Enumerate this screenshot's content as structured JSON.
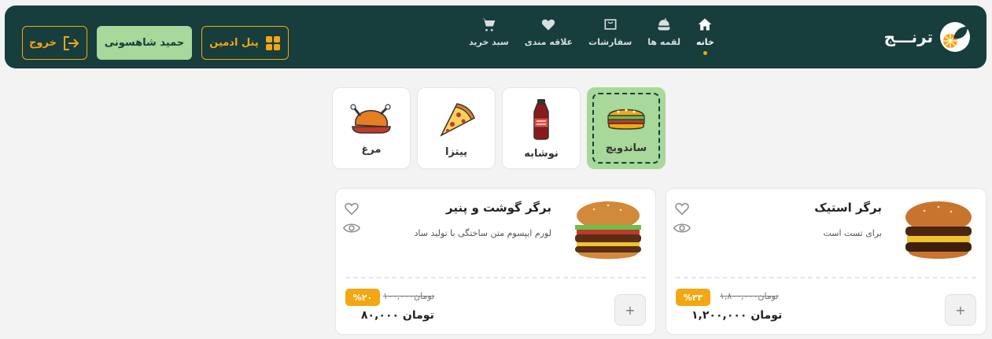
{
  "brand": {
    "name": "ترنـــج"
  },
  "nav": [
    {
      "label": "خانه",
      "icon": "home-icon",
      "active": true
    },
    {
      "label": "لقمه ها",
      "icon": "food-icon"
    },
    {
      "label": "سفارشات",
      "icon": "orders-icon"
    },
    {
      "label": "علاقه مندی",
      "icon": "heart-icon"
    },
    {
      "label": "سبد خرید",
      "icon": "cart-icon"
    }
  ],
  "header": {
    "admin_label": "پنل ادمین",
    "user_label": "حمید شاهسونی",
    "logout_label": "خروج"
  },
  "categories": [
    {
      "label": "ساندویچ",
      "icon": "sandwich-icon",
      "active": true
    },
    {
      "label": "نوشابه",
      "icon": "soda-icon"
    },
    {
      "label": "پیتزا",
      "icon": "pizza-icon"
    },
    {
      "label": "مرغ",
      "icon": "chicken-icon"
    }
  ],
  "products": [
    {
      "title": "برگر استیک",
      "desc": "برای تست است",
      "discount": "%۳۳",
      "old_price": "۱,۸۰۰,۰۰۰تومان",
      "price": "۱,۲۰۰,۰۰۰ تومان"
    },
    {
      "title": "برگر گوشت و پنیر",
      "desc": "لورم ایپسوم متن ساختگی با تولید ساد",
      "discount": "%۲۰",
      "old_price": "۱۰۰,۰۰۰تومان",
      "price": "۸۰,۰۰۰ تومان"
    }
  ],
  "colors": {
    "nav_bg": "#173d3d",
    "accent": "#f3a712",
    "active_green": "#a8d89a"
  }
}
